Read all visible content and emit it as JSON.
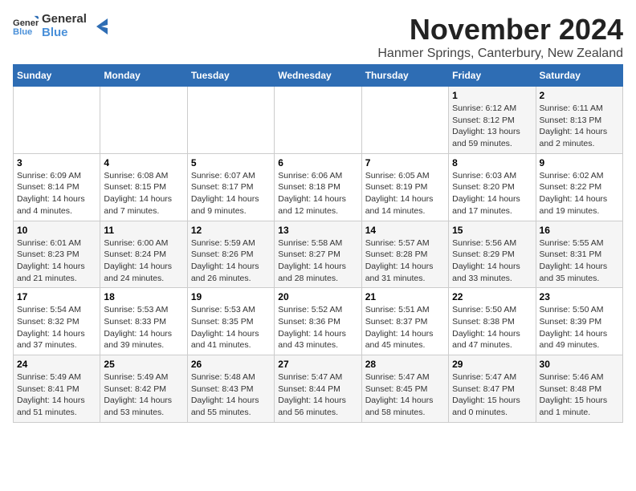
{
  "logo": {
    "line1": "General",
    "line2": "Blue"
  },
  "title": "November 2024",
  "subtitle": "Hanmer Springs, Canterbury, New Zealand",
  "weekdays": [
    "Sunday",
    "Monday",
    "Tuesday",
    "Wednesday",
    "Thursday",
    "Friday",
    "Saturday"
  ],
  "weeks": [
    [
      {
        "day": "",
        "info": ""
      },
      {
        "day": "",
        "info": ""
      },
      {
        "day": "",
        "info": ""
      },
      {
        "day": "",
        "info": ""
      },
      {
        "day": "",
        "info": ""
      },
      {
        "day": "1",
        "info": "Sunrise: 6:12 AM\nSunset: 8:12 PM\nDaylight: 13 hours and 59 minutes."
      },
      {
        "day": "2",
        "info": "Sunrise: 6:11 AM\nSunset: 8:13 PM\nDaylight: 14 hours and 2 minutes."
      }
    ],
    [
      {
        "day": "3",
        "info": "Sunrise: 6:09 AM\nSunset: 8:14 PM\nDaylight: 14 hours and 4 minutes."
      },
      {
        "day": "4",
        "info": "Sunrise: 6:08 AM\nSunset: 8:15 PM\nDaylight: 14 hours and 7 minutes."
      },
      {
        "day": "5",
        "info": "Sunrise: 6:07 AM\nSunset: 8:17 PM\nDaylight: 14 hours and 9 minutes."
      },
      {
        "day": "6",
        "info": "Sunrise: 6:06 AM\nSunset: 8:18 PM\nDaylight: 14 hours and 12 minutes."
      },
      {
        "day": "7",
        "info": "Sunrise: 6:05 AM\nSunset: 8:19 PM\nDaylight: 14 hours and 14 minutes."
      },
      {
        "day": "8",
        "info": "Sunrise: 6:03 AM\nSunset: 8:20 PM\nDaylight: 14 hours and 17 minutes."
      },
      {
        "day": "9",
        "info": "Sunrise: 6:02 AM\nSunset: 8:22 PM\nDaylight: 14 hours and 19 minutes."
      }
    ],
    [
      {
        "day": "10",
        "info": "Sunrise: 6:01 AM\nSunset: 8:23 PM\nDaylight: 14 hours and 21 minutes."
      },
      {
        "day": "11",
        "info": "Sunrise: 6:00 AM\nSunset: 8:24 PM\nDaylight: 14 hours and 24 minutes."
      },
      {
        "day": "12",
        "info": "Sunrise: 5:59 AM\nSunset: 8:26 PM\nDaylight: 14 hours and 26 minutes."
      },
      {
        "day": "13",
        "info": "Sunrise: 5:58 AM\nSunset: 8:27 PM\nDaylight: 14 hours and 28 minutes."
      },
      {
        "day": "14",
        "info": "Sunrise: 5:57 AM\nSunset: 8:28 PM\nDaylight: 14 hours and 31 minutes."
      },
      {
        "day": "15",
        "info": "Sunrise: 5:56 AM\nSunset: 8:29 PM\nDaylight: 14 hours and 33 minutes."
      },
      {
        "day": "16",
        "info": "Sunrise: 5:55 AM\nSunset: 8:31 PM\nDaylight: 14 hours and 35 minutes."
      }
    ],
    [
      {
        "day": "17",
        "info": "Sunrise: 5:54 AM\nSunset: 8:32 PM\nDaylight: 14 hours and 37 minutes."
      },
      {
        "day": "18",
        "info": "Sunrise: 5:53 AM\nSunset: 8:33 PM\nDaylight: 14 hours and 39 minutes."
      },
      {
        "day": "19",
        "info": "Sunrise: 5:53 AM\nSunset: 8:35 PM\nDaylight: 14 hours and 41 minutes."
      },
      {
        "day": "20",
        "info": "Sunrise: 5:52 AM\nSunset: 8:36 PM\nDaylight: 14 hours and 43 minutes."
      },
      {
        "day": "21",
        "info": "Sunrise: 5:51 AM\nSunset: 8:37 PM\nDaylight: 14 hours and 45 minutes."
      },
      {
        "day": "22",
        "info": "Sunrise: 5:50 AM\nSunset: 8:38 PM\nDaylight: 14 hours and 47 minutes."
      },
      {
        "day": "23",
        "info": "Sunrise: 5:50 AM\nSunset: 8:39 PM\nDaylight: 14 hours and 49 minutes."
      }
    ],
    [
      {
        "day": "24",
        "info": "Sunrise: 5:49 AM\nSunset: 8:41 PM\nDaylight: 14 hours and 51 minutes."
      },
      {
        "day": "25",
        "info": "Sunrise: 5:49 AM\nSunset: 8:42 PM\nDaylight: 14 hours and 53 minutes."
      },
      {
        "day": "26",
        "info": "Sunrise: 5:48 AM\nSunset: 8:43 PM\nDaylight: 14 hours and 55 minutes."
      },
      {
        "day": "27",
        "info": "Sunrise: 5:47 AM\nSunset: 8:44 PM\nDaylight: 14 hours and 56 minutes."
      },
      {
        "day": "28",
        "info": "Sunrise: 5:47 AM\nSunset: 8:45 PM\nDaylight: 14 hours and 58 minutes."
      },
      {
        "day": "29",
        "info": "Sunrise: 5:47 AM\nSunset: 8:47 PM\nDaylight: 15 hours and 0 minutes."
      },
      {
        "day": "30",
        "info": "Sunrise: 5:46 AM\nSunset: 8:48 PM\nDaylight: 15 hours and 1 minute."
      }
    ]
  ]
}
